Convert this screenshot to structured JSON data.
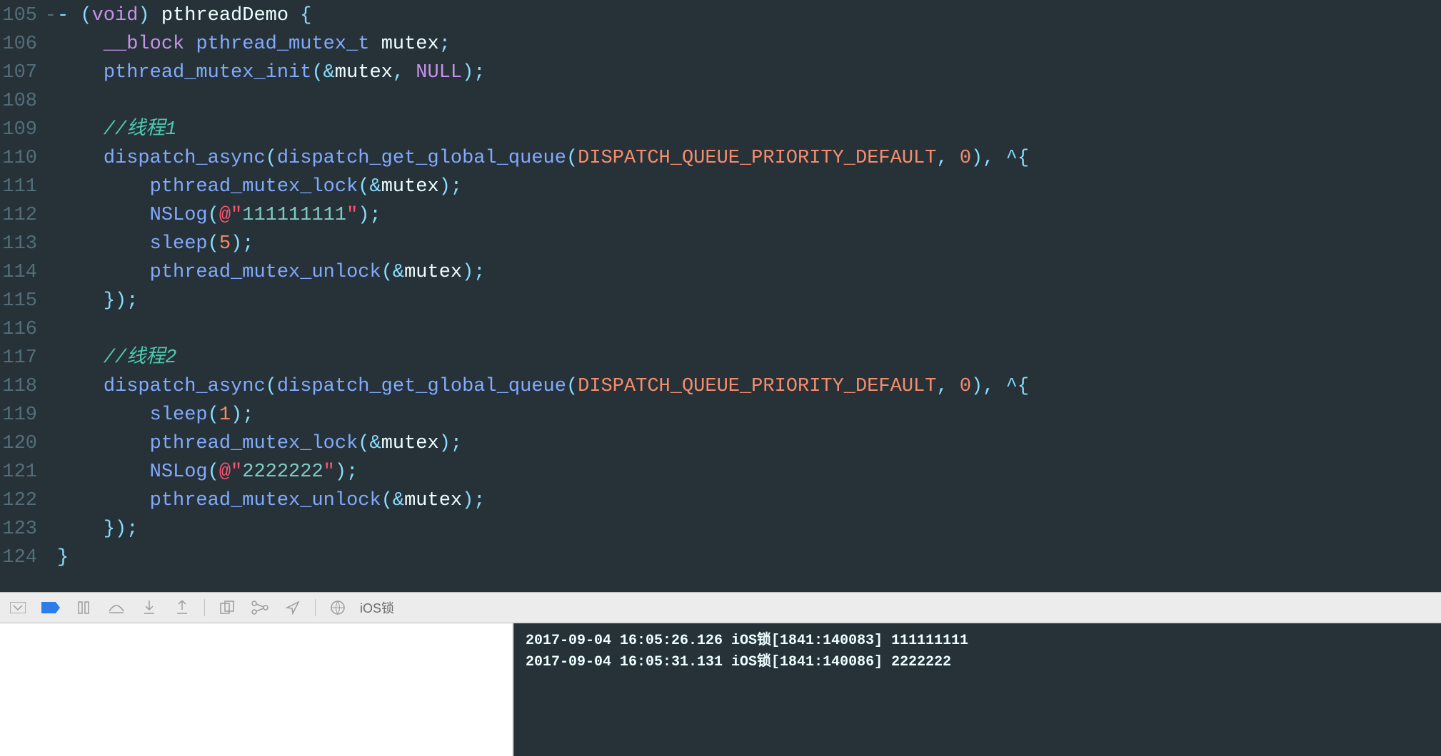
{
  "editor": {
    "startLine": 105,
    "lines": [
      {
        "n": 105,
        "fold": "-",
        "seg": [
          {
            "c": "t-punct",
            "t": "- ("
          },
          {
            "c": "t-keyword",
            "t": "void"
          },
          {
            "c": "t-punct",
            "t": ") "
          },
          {
            "c": "t-ident",
            "t": "pthreadDemo "
          },
          {
            "c": "t-punct",
            "t": "{"
          }
        ]
      },
      {
        "n": 106,
        "fold": "",
        "seg": [
          {
            "c": "",
            "t": "    "
          },
          {
            "c": "t-keyword",
            "t": "__block"
          },
          {
            "c": "",
            "t": " "
          },
          {
            "c": "t-type",
            "t": "pthread_mutex_t"
          },
          {
            "c": "",
            "t": " "
          },
          {
            "c": "t-ident",
            "t": "mutex"
          },
          {
            "c": "t-punct",
            "t": ";"
          }
        ]
      },
      {
        "n": 107,
        "fold": "",
        "seg": [
          {
            "c": "",
            "t": "    "
          },
          {
            "c": "t-func",
            "t": "pthread_mutex_init"
          },
          {
            "c": "t-punct",
            "t": "(&"
          },
          {
            "c": "t-ident",
            "t": "mutex"
          },
          {
            "c": "t-punct",
            "t": ", "
          },
          {
            "c": "t-null",
            "t": "NULL"
          },
          {
            "c": "t-punct",
            "t": ");"
          }
        ]
      },
      {
        "n": 108,
        "fold": "",
        "seg": [
          {
            "c": "",
            "t": "    "
          }
        ]
      },
      {
        "n": 109,
        "fold": "",
        "seg": [
          {
            "c": "",
            "t": "    "
          },
          {
            "c": "t-comment",
            "t": "//线程1"
          }
        ]
      },
      {
        "n": 110,
        "fold": "",
        "seg": [
          {
            "c": "",
            "t": "    "
          },
          {
            "c": "t-func",
            "t": "dispatch_async"
          },
          {
            "c": "t-punct",
            "t": "("
          },
          {
            "c": "t-func",
            "t": "dispatch_get_global_queue"
          },
          {
            "c": "t-punct",
            "t": "("
          },
          {
            "c": "t-const",
            "t": "DISPATCH_QUEUE_PRIORITY_DEFAULT"
          },
          {
            "c": "t-punct",
            "t": ", "
          },
          {
            "c": "t-num",
            "t": "0"
          },
          {
            "c": "t-punct",
            "t": "), ^{"
          }
        ]
      },
      {
        "n": 111,
        "fold": "",
        "seg": [
          {
            "c": "",
            "t": "        "
          },
          {
            "c": "t-func",
            "t": "pthread_mutex_lock"
          },
          {
            "c": "t-punct",
            "t": "(&"
          },
          {
            "c": "t-ident",
            "t": "mutex"
          },
          {
            "c": "t-punct",
            "t": ");"
          }
        ]
      },
      {
        "n": 112,
        "fold": "",
        "seg": [
          {
            "c": "",
            "t": "        "
          },
          {
            "c": "t-func",
            "t": "NSLog"
          },
          {
            "c": "t-punct",
            "t": "("
          },
          {
            "c": "t-at",
            "t": "@\""
          },
          {
            "c": "t-string",
            "t": "111111111"
          },
          {
            "c": "t-at",
            "t": "\""
          },
          {
            "c": "t-punct",
            "t": ");"
          }
        ]
      },
      {
        "n": 113,
        "fold": "",
        "seg": [
          {
            "c": "",
            "t": "        "
          },
          {
            "c": "t-func",
            "t": "sleep"
          },
          {
            "c": "t-punct",
            "t": "("
          },
          {
            "c": "t-num",
            "t": "5"
          },
          {
            "c": "t-punct",
            "t": ");"
          }
        ]
      },
      {
        "n": 114,
        "fold": "",
        "seg": [
          {
            "c": "",
            "t": "        "
          },
          {
            "c": "t-func",
            "t": "pthread_mutex_unlock"
          },
          {
            "c": "t-punct",
            "t": "(&"
          },
          {
            "c": "t-ident",
            "t": "mutex"
          },
          {
            "c": "t-punct",
            "t": ");"
          }
        ]
      },
      {
        "n": 115,
        "fold": "",
        "seg": [
          {
            "c": "",
            "t": "    "
          },
          {
            "c": "t-punct",
            "t": "});"
          }
        ]
      },
      {
        "n": 116,
        "fold": "",
        "seg": [
          {
            "c": "",
            "t": "    "
          }
        ]
      },
      {
        "n": 117,
        "fold": "",
        "seg": [
          {
            "c": "",
            "t": "    "
          },
          {
            "c": "t-comment",
            "t": "//线程2"
          }
        ]
      },
      {
        "n": 118,
        "fold": "",
        "seg": [
          {
            "c": "",
            "t": "    "
          },
          {
            "c": "t-func",
            "t": "dispatch_async"
          },
          {
            "c": "t-punct",
            "t": "("
          },
          {
            "c": "t-func",
            "t": "dispatch_get_global_queue"
          },
          {
            "c": "t-punct",
            "t": "("
          },
          {
            "c": "t-const",
            "t": "DISPATCH_QUEUE_PRIORITY_DEFAULT"
          },
          {
            "c": "t-punct",
            "t": ", "
          },
          {
            "c": "t-num",
            "t": "0"
          },
          {
            "c": "t-punct",
            "t": "), ^{"
          }
        ]
      },
      {
        "n": 119,
        "fold": "",
        "seg": [
          {
            "c": "",
            "t": "        "
          },
          {
            "c": "t-func",
            "t": "sleep"
          },
          {
            "c": "t-punct",
            "t": "("
          },
          {
            "c": "t-num",
            "t": "1"
          },
          {
            "c": "t-punct",
            "t": ");"
          }
        ]
      },
      {
        "n": 120,
        "fold": "",
        "seg": [
          {
            "c": "",
            "t": "        "
          },
          {
            "c": "t-func",
            "t": "pthread_mutex_lock"
          },
          {
            "c": "t-punct",
            "t": "(&"
          },
          {
            "c": "t-ident",
            "t": "mutex"
          },
          {
            "c": "t-punct",
            "t": ");"
          }
        ]
      },
      {
        "n": 121,
        "fold": "",
        "seg": [
          {
            "c": "",
            "t": "        "
          },
          {
            "c": "t-func",
            "t": "NSLog"
          },
          {
            "c": "t-punct",
            "t": "("
          },
          {
            "c": "t-at",
            "t": "@\""
          },
          {
            "c": "t-string",
            "t": "2222222"
          },
          {
            "c": "t-at",
            "t": "\""
          },
          {
            "c": "t-punct",
            "t": ");"
          }
        ]
      },
      {
        "n": 122,
        "fold": "",
        "seg": [
          {
            "c": "",
            "t": "        "
          },
          {
            "c": "t-func",
            "t": "pthread_mutex_unlock"
          },
          {
            "c": "t-punct",
            "t": "(&"
          },
          {
            "c": "t-ident",
            "t": "mutex"
          },
          {
            "c": "t-punct",
            "t": ");"
          }
        ]
      },
      {
        "n": 123,
        "fold": "",
        "seg": [
          {
            "c": "",
            "t": "    "
          },
          {
            "c": "t-punct",
            "t": "});"
          }
        ]
      },
      {
        "n": 124,
        "fold": "",
        "seg": [
          {
            "c": "t-punct",
            "t": "}"
          }
        ]
      }
    ]
  },
  "toolbar": {
    "scheme": "iOS锁"
  },
  "console": {
    "lines": [
      "2017-09-04 16:05:26.126 iOS锁[1841:140083] 111111111",
      "2017-09-04 16:05:31.131 iOS锁[1841:140086] 2222222"
    ]
  }
}
